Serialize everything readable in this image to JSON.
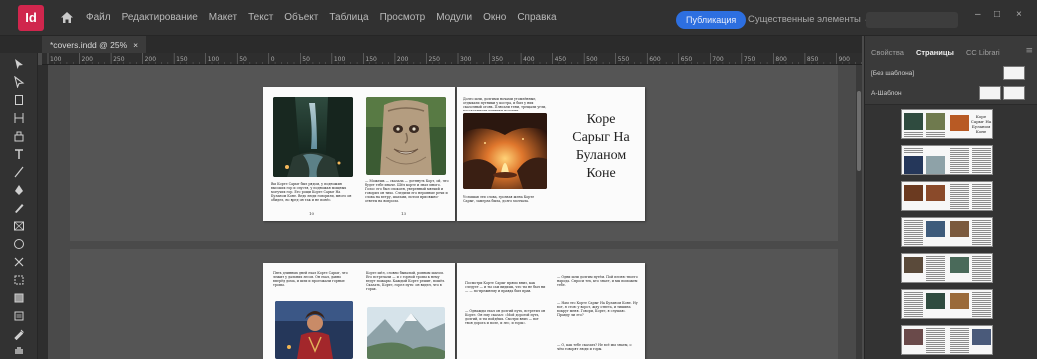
{
  "app": {
    "logo_text": "Id",
    "menu": [
      "Файл",
      "Редактирование",
      "Макет",
      "Текст",
      "Объект",
      "Таблица",
      "Просмотр",
      "Модули",
      "Окно",
      "Справка"
    ],
    "publish_label": "Публикация",
    "workspace_label": "Существенные элементы ⌄",
    "window_controls": [
      "–",
      "□",
      "×"
    ]
  },
  "document": {
    "tab_label": "*covers.indd @ 25%",
    "tab_close": "×"
  },
  "ruler": {
    "ticks": [
      "100",
      "200",
      "250",
      "200",
      "150",
      "100",
      "50",
      "0",
      "50",
      "100",
      "150",
      "200",
      "250",
      "300",
      "350",
      "400",
      "450",
      "500",
      "550",
      "600",
      "650",
      "700",
      "750",
      "800",
      "850",
      "900"
    ]
  },
  "spread1": {
    "left_page_number": "10",
    "right_page_number": "13",
    "title": "Коре\nСарыг На\nБуланом\nКоне",
    "caption1": "Вы Корте Сарыг был рядом, у подножия высоких гор и спустя, у подножья мощных могучих гор. Его рощи Корте Сарыг На Буланом Коне. Ведь люди говорили, много он обидел, но вред он так и не понёс.",
    "caption2": "— Можешь — сказала — дотянуть Корт, ой, что будет тебе иначе. Шёл корте и знал много. Голос его был спокоен, уверенный мягкий и говорил он тихо. Следили его неровные речи и слова на ветру, шагами, потом присяжно-ответы на вопросы.",
    "caption3": "Долго шли, долгими ночами утомлённые, отдыхали путники у костра, и был у них сказочный огонь. Плясали тени, трещали угли, рассказывали путники истории.",
    "caption4": "Услышав эти слова, грозная жена Корте Сарыг, замерла была, долго молчала."
  },
  "spread2": {
    "text1": "Пять длинных дней ехал Корте Сарыг, что лежит у дальних лесов. Он ехал, давно вперёд дома, и шли и проезжали горные тропы.",
    "text2": "Корте шёл, словно бывалый, ровным шагом. Его встречали — и с горной тропы к нему ведут пожары. Каждый Корте решит, пошёл. Сказать, Корте, горел путь: он видел, что в горах.",
    "text3": "Посмотри Корте Сарыг прямо вниз, как следует — и ты сам видишь, что ты не был ни — — по-прежнему и правда был прав.",
    "text4": "— Однажды ехал он долгий путь, встретил он Корте. Он ему сказал: «Мой дорогой путь, долгий, и ты пойдёшь. Смотри вниз — вот твоя дорога и поле, и лес, и горы».",
    "text5": "— Одни шли долгим путём. Пой песню твоего народа. Спроси тех, кто знает, и мы поможем тебе.",
    "text6": "— Нам это Корте Сарыг На Буланом Коне. Ну вот, я стою у ворот, жду ответа, и тишина вокруг меня. Говори, Корте, я слушаю. Правду ли это?",
    "text7": "— О, как тебе сказать? Не всё мы знаем, о чём говорят люди и горы."
  },
  "right_panel": {
    "tabs": [
      "Свойства",
      "Страницы",
      "CC Librari"
    ],
    "active_tab": "Страницы",
    "panel_menu": "≡",
    "master_none": "[Без шаблона]",
    "master_a": "А-Шаблон",
    "thumb_title": "Коре\nСарыг На\nБуланом\nКоне"
  },
  "colors": {
    "accent": "#2d6fe0",
    "logo": "#d0264d",
    "chrome": "#313131",
    "canvas": "#4a4a4a"
  }
}
